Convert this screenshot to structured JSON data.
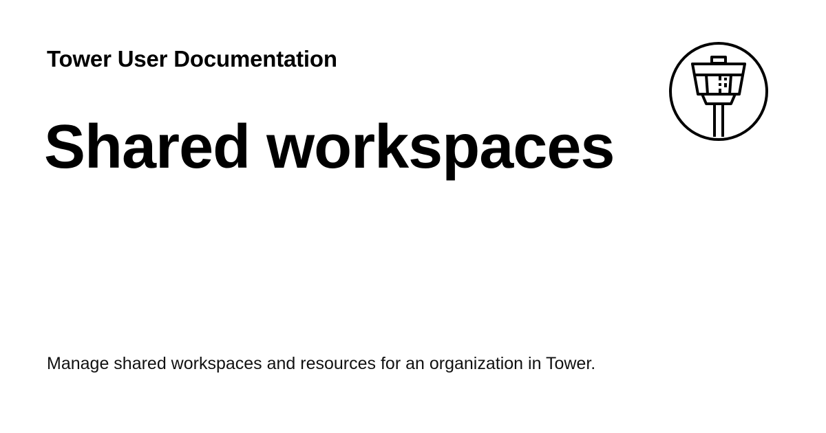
{
  "header": {
    "site_name": "Tower User Documentation",
    "logo_icon": "control-tower-icon"
  },
  "main": {
    "title": "Shared workspaces",
    "description": "Manage shared workspaces and resources for an organization in Tower."
  },
  "colors": {
    "background": "#ffffff",
    "text": "#000000"
  }
}
